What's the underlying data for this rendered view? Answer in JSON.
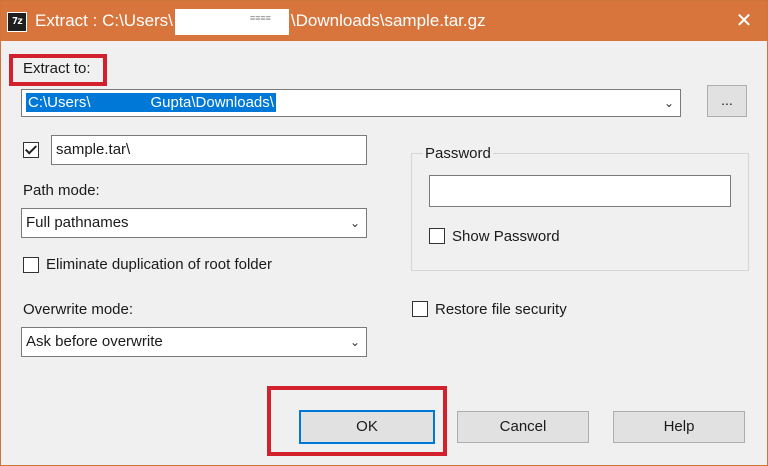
{
  "window": {
    "title_prefix": "Extract : C:\\Users\\",
    "title_redacted": "≡≡≡≡",
    "title_suffix": "\\Downloads\\sample.tar.gz",
    "app_icon": "7z",
    "close_glyph": "✕"
  },
  "extract_to": {
    "label": "Extract to:",
    "path_prefix": "C:\\Users\\",
    "path_suffix": "Gupta\\Downloads\\",
    "browse_label": "..."
  },
  "subfolder": {
    "checked": true,
    "value": "sample.tar\\"
  },
  "path_mode": {
    "label": "Path mode:",
    "selected": "Full pathnames"
  },
  "eliminate_dup": {
    "label": "Eliminate duplication of root folder",
    "checked": false
  },
  "overwrite_mode": {
    "label": "Overwrite mode:",
    "selected": "Ask before overwrite"
  },
  "password": {
    "group_label": "Password",
    "value": "",
    "show_label": "Show Password",
    "show_checked": false
  },
  "restore_security": {
    "label": "Restore file security",
    "checked": false
  },
  "buttons": {
    "ok": "OK",
    "cancel": "Cancel",
    "help": "Help"
  },
  "colors": {
    "titlebar": "#d8753c",
    "highlight": "#d3202d",
    "selection": "#0078d7"
  },
  "icons": {
    "app": "7zip-icon",
    "close": "close-icon",
    "dropdown": "chevron-down-icon",
    "check": "checkmark-icon"
  }
}
